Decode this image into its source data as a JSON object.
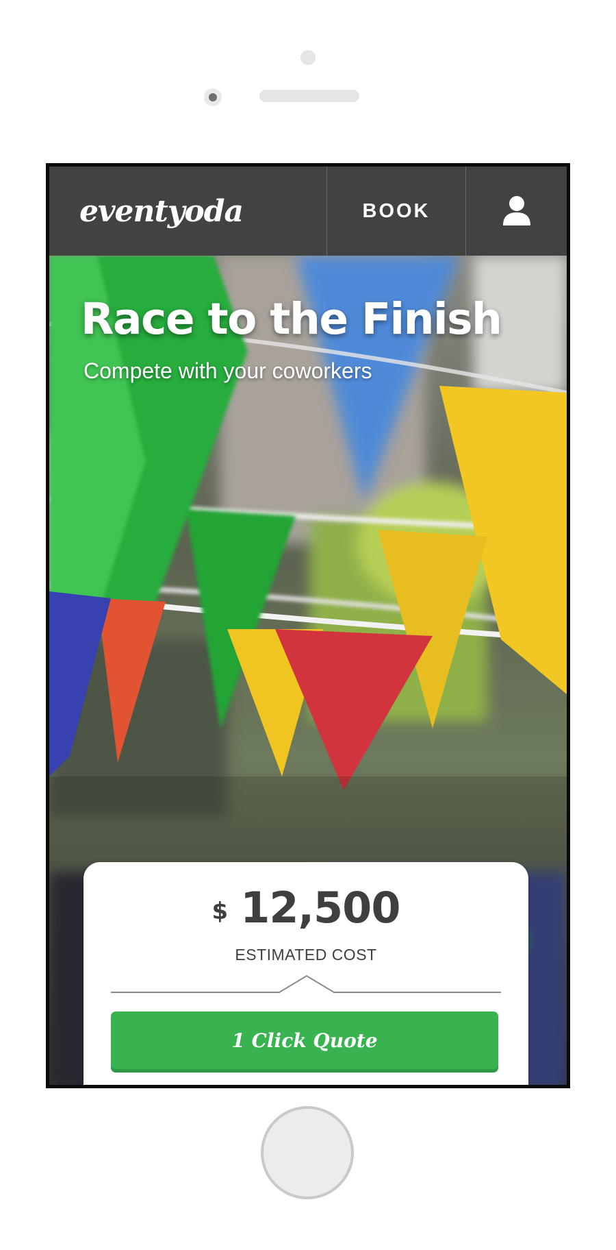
{
  "device": {
    "sensor_icon": "proximity-sensor",
    "camera_icon": "front-camera",
    "speaker_icon": "speaker-grille",
    "home_button_icon": "home-button"
  },
  "navbar": {
    "logo_text": "eventyoda",
    "book_label": "BOOK",
    "user_icon": "user-icon",
    "background_color": "#424242"
  },
  "hero": {
    "title": "Race to the Finish",
    "subtitle": "Compete with your coworkers"
  },
  "quote_card": {
    "currency": "$",
    "amount": "12,500",
    "cost_label": "ESTIMATED COST",
    "button_label": "1 Click Quote",
    "button_color": "#38b34f"
  }
}
